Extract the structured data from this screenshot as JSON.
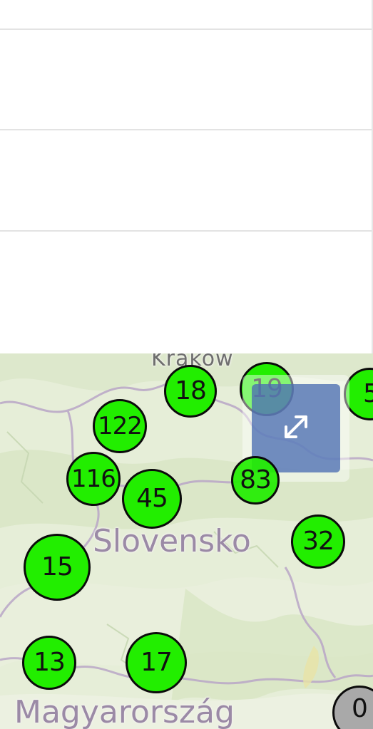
{
  "list": {
    "rows": [
      "",
      "",
      ""
    ]
  },
  "map": {
    "place_labels": {
      "city_top": "Kraków",
      "country_center": "Slovensko",
      "country_bottom": "Magyarország"
    },
    "clusters": [
      {
        "count": "18"
      },
      {
        "count": "19"
      },
      {
        "count": "5"
      },
      {
        "count": "122"
      },
      {
        "count": "116"
      },
      {
        "count": "45"
      },
      {
        "count": "83"
      },
      {
        "count": "32"
      },
      {
        "count": "15"
      },
      {
        "count": "13"
      },
      {
        "count": "17"
      },
      {
        "count": "0"
      }
    ],
    "fullscreen_icon": "expand-arrows-icon",
    "colors": {
      "cluster_fill": "#22ee00",
      "cluster_empty": "#a9a9a9",
      "cluster_border": "#0b0b0b",
      "fullscreen_button": "#4c6eb2"
    }
  }
}
